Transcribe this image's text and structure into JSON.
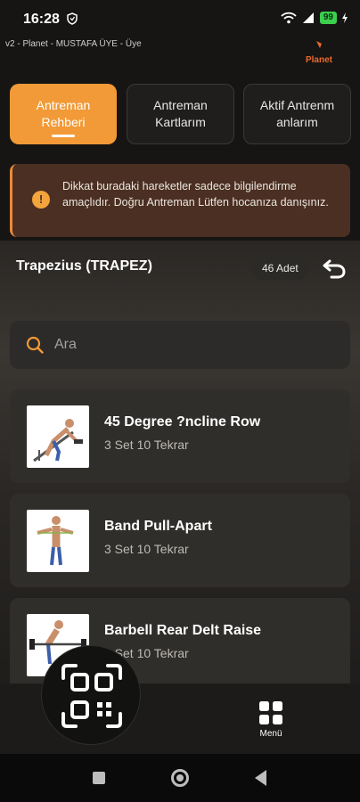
{
  "status_bar": {
    "time": "16:28",
    "battery": "99"
  },
  "header": {
    "subtitle": "v2 - Planet - MUSTAFA ÜYE - Üye",
    "brand": "Planet"
  },
  "tabs": [
    {
      "label_line1": "Antreman",
      "label_line2": "Rehberi",
      "active": true
    },
    {
      "label_line1": "Antreman",
      "label_line2": "Kartlarım",
      "active": false
    },
    {
      "label_line1": "Aktif Antrenm",
      "label_line2": "anlarım",
      "active": false
    }
  ],
  "notice": {
    "icon": "info-icon",
    "text": "Dikkat buradaki hareketler sadece bilgilendirme amaçlıdır. Doğru Antreman Lütfen hocanıza danışınız."
  },
  "section": {
    "title": "Trapezius (TRAPEZ)",
    "count": "46 Adet",
    "back_icon": "undo-icon"
  },
  "search": {
    "placeholder": "Ara",
    "value": ""
  },
  "exercises": [
    {
      "name": "45 Degree ?ncline Row",
      "detail": "3 Set 10 Tekrar"
    },
    {
      "name": "Band Pull-Apart",
      "detail": "3 Set 10 Tekrar"
    },
    {
      "name": "Barbell Rear Delt Raise",
      "detail": "3 Set 10 Tekrar"
    }
  ],
  "bottom_nav": {
    "qr_icon": "qr-scan-icon",
    "menu_label": "Menü",
    "menu_icon": "grid-icon"
  },
  "colors": {
    "accent": "#f29a37",
    "notice_bg": "#4a2f22",
    "card_bg": "#302e2b"
  }
}
